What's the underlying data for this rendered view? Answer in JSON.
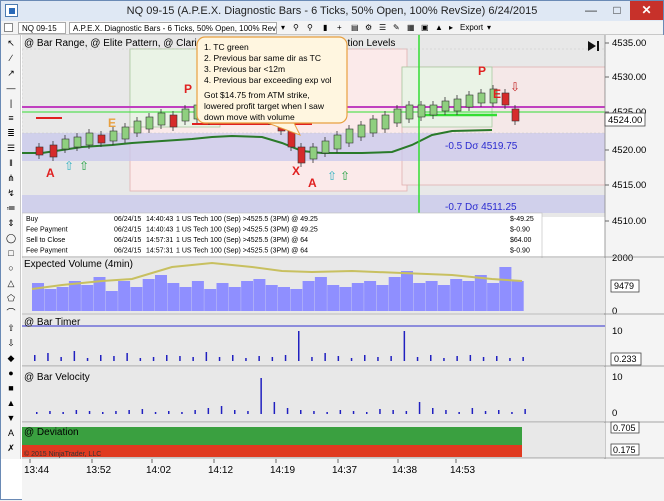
{
  "window": {
    "title": "NQ 09-15 (A.P.E.X. Diagnostic Bars - 6 Ticks, 50% Open, 100% RevSize)  6/24/2015"
  },
  "toolbar": {
    "instrument": "NQ 09-15",
    "bar_type": "A.P.E.X. Diagnostic Bars - 6 Ticks, 50% Open, 100% RevSize",
    "export_label": "Export"
  },
  "panels": {
    "price": {
      "label": "@ Bar Range, @ Elite Pattern, @ Clari",
      "label_right": "ation Levels",
      "y_ticks": [
        "4535.00",
        "4530.00",
        "4525.00",
        "4520.00",
        "4515.00",
        "4510.00"
      ],
      "last_price": "4524.00",
      "level_1": "-0.5 Dσ 4519.75",
      "level_2": "-0.7 Dσ 4511.25",
      "bar_letters": [
        "A",
        "E",
        "P",
        "X",
        "A",
        "P",
        "E"
      ]
    },
    "volume": {
      "label": "Expected Volume (4min)",
      "y_ticks": [
        "2000",
        "0"
      ],
      "value": "9479"
    },
    "timer": {
      "label": "@ Bar Timer",
      "y_ticks": [
        "10",
        "0"
      ],
      "value": "0.233"
    },
    "velocity": {
      "label": "@ Bar Velocity",
      "y_ticks": [
        "10",
        "0"
      ]
    },
    "deviation": {
      "label": "@ Deviation",
      "values": [
        "0.705",
        "0.175"
      ],
      "copyright": "© 2015 NinjaTrader, LLC"
    }
  },
  "annotation": {
    "lines": [
      "1. TC green",
      "2. Previous bar same dir as TC",
      "3. Previous bar <12m",
      "4. Previous bar exceeding exp vol"
    ],
    "note": [
      "Got $14.75 from ATM strike,",
      "lowered profit target when I saw",
      "down move with volume"
    ]
  },
  "trades": [
    {
      "action": "Buy",
      "date": "06/24/15",
      "time": "14:40:43",
      "desc": "1 US Tech 100 (Sep) >4525.5 (3PM) @ 49.25",
      "amount": "$-49.25"
    },
    {
      "action": "Fee Payment",
      "date": "06/24/15",
      "time": "14:40:43",
      "desc": "1 US Tech 100 (Sep) >4525.5 (3PM) @ 49.25",
      "amount": "$-0.90"
    },
    {
      "action": "Sell to Close",
      "date": "06/24/15",
      "time": "14:57:31",
      "desc": "1 US Tech 100 (Sep) >4525.5 (3PM) @ 64",
      "amount": "$64.00"
    },
    {
      "action": "Fee Payment",
      "date": "06/24/15",
      "time": "14:57:31",
      "desc": "1 US Tech 100 (Sep) >4525.5 (3PM) @ 64",
      "amount": "$-0.90"
    }
  ],
  "x_axis": [
    "13:44",
    "13:52",
    "14:02",
    "14:12",
    "14:19",
    "14:37",
    "14:38",
    "14:53"
  ],
  "colors": {
    "up": "#8fcf7f",
    "down": "#d62b2b",
    "magenta": "#c040c0",
    "green_line": "#2a7a2a",
    "vol": "#8f8fff",
    "crosshair": "#33dd33"
  }
}
